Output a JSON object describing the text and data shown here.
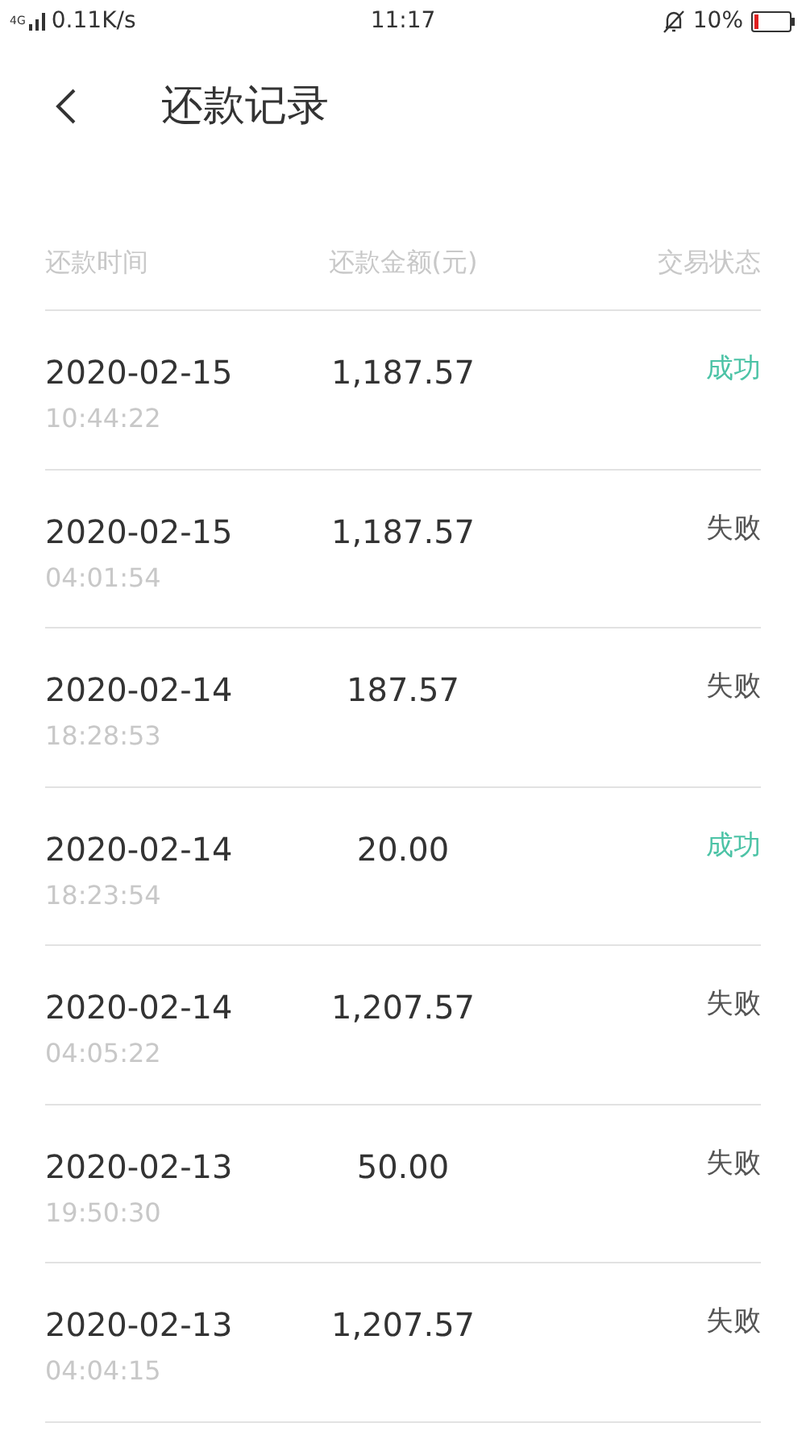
{
  "status_bar": {
    "network": "4G",
    "speed": "0.11K/s",
    "time": "11:17",
    "battery": "10%"
  },
  "header": {
    "title": "还款记录"
  },
  "table": {
    "columns": [
      "还款时间",
      "还款金额(元)",
      "交易状态"
    ],
    "rows": [
      {
        "date": "2020-02-15",
        "time": "10:44:22",
        "amount": "1,187.57",
        "status": "成功",
        "kind": "success"
      },
      {
        "date": "2020-02-15",
        "time": "04:01:54",
        "amount": "1,187.57",
        "status": "失败",
        "kind": "failure"
      },
      {
        "date": "2020-02-14",
        "time": "18:28:53",
        "amount": "187.57",
        "status": "失败",
        "kind": "failure"
      },
      {
        "date": "2020-02-14",
        "time": "18:23:54",
        "amount": "20.00",
        "status": "成功",
        "kind": "success"
      },
      {
        "date": "2020-02-14",
        "time": "04:05:22",
        "amount": "1,207.57",
        "status": "失败",
        "kind": "failure"
      },
      {
        "date": "2020-02-13",
        "time": "19:50:30",
        "amount": "50.00",
        "status": "失败",
        "kind": "failure"
      },
      {
        "date": "2020-02-13",
        "time": "04:04:15",
        "amount": "1,207.57",
        "status": "失败",
        "kind": "failure"
      }
    ]
  }
}
